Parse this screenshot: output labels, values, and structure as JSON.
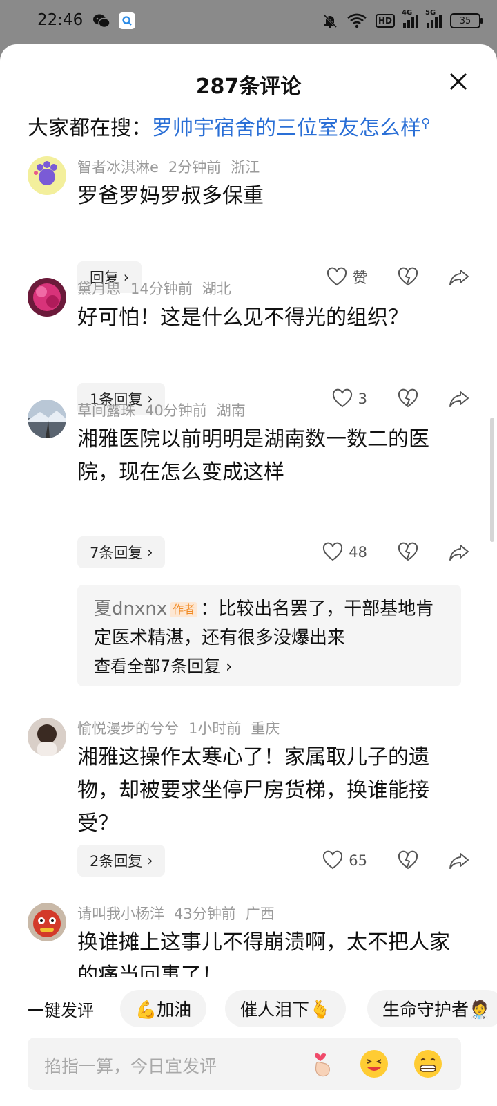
{
  "status": {
    "time": "22:46",
    "hd": "HD",
    "net1": "4G",
    "net2": "5G",
    "battery": "35"
  },
  "sheet": {
    "title": "287条评论",
    "hot_search_prefix": "大家都在搜：",
    "hot_search_link": "罗帅宇宿舍的三位室友怎么样"
  },
  "comments": [
    {
      "user": "智者冰淇淋e",
      "time": "2分钟前",
      "region": "浙江",
      "text": "罗爸罗妈罗叔多保重",
      "reply_label": "回复",
      "likes": "赞"
    },
    {
      "user": "黛月思",
      "time": "14分钟前",
      "region": "湖北",
      "text": "好可怕！这是什么见不得光的组织？",
      "reply_label": "1条回复",
      "likes": "3"
    },
    {
      "user": "草间露珠",
      "time": "40分钟前",
      "region": "湖南",
      "text": "湘雅医院以前明明是湖南数一数二的医院，现在怎么变成这样",
      "reply_label": "7条回复",
      "likes": "48",
      "sub_reply": {
        "user": "夏dnxnx",
        "tag": "作者",
        "text": "：比较出名罢了，干部基地肯定医术精湛，还有很多没爆出来",
        "view_all": "查看全部7条回复"
      }
    },
    {
      "user": "愉悦漫步的兮兮",
      "time": "1小时前",
      "region": "重庆",
      "text": "湘雅这操作太寒心了！家属取儿子的遗物，却被要求坐停尸房货梯，换谁能接受？",
      "reply_label": "2条回复",
      "likes": "65"
    },
    {
      "user": "请叫我小杨洋",
      "time": "43分钟前",
      "region": "广西",
      "text": "换谁摊上这事儿不得崩溃啊，太不把人家的痛当回事了！"
    }
  ],
  "quick_comment": {
    "label": "一键发评",
    "chips": [
      "💪加油",
      "催人泪下🫰",
      "生命守护者🧑‍⚕️"
    ]
  },
  "input": {
    "placeholder": "掐指一算，今日宜发评"
  },
  "colors": {
    "link": "#2a6fd6",
    "author_tag": "#f08a24",
    "meta": "#9a9a9a"
  }
}
